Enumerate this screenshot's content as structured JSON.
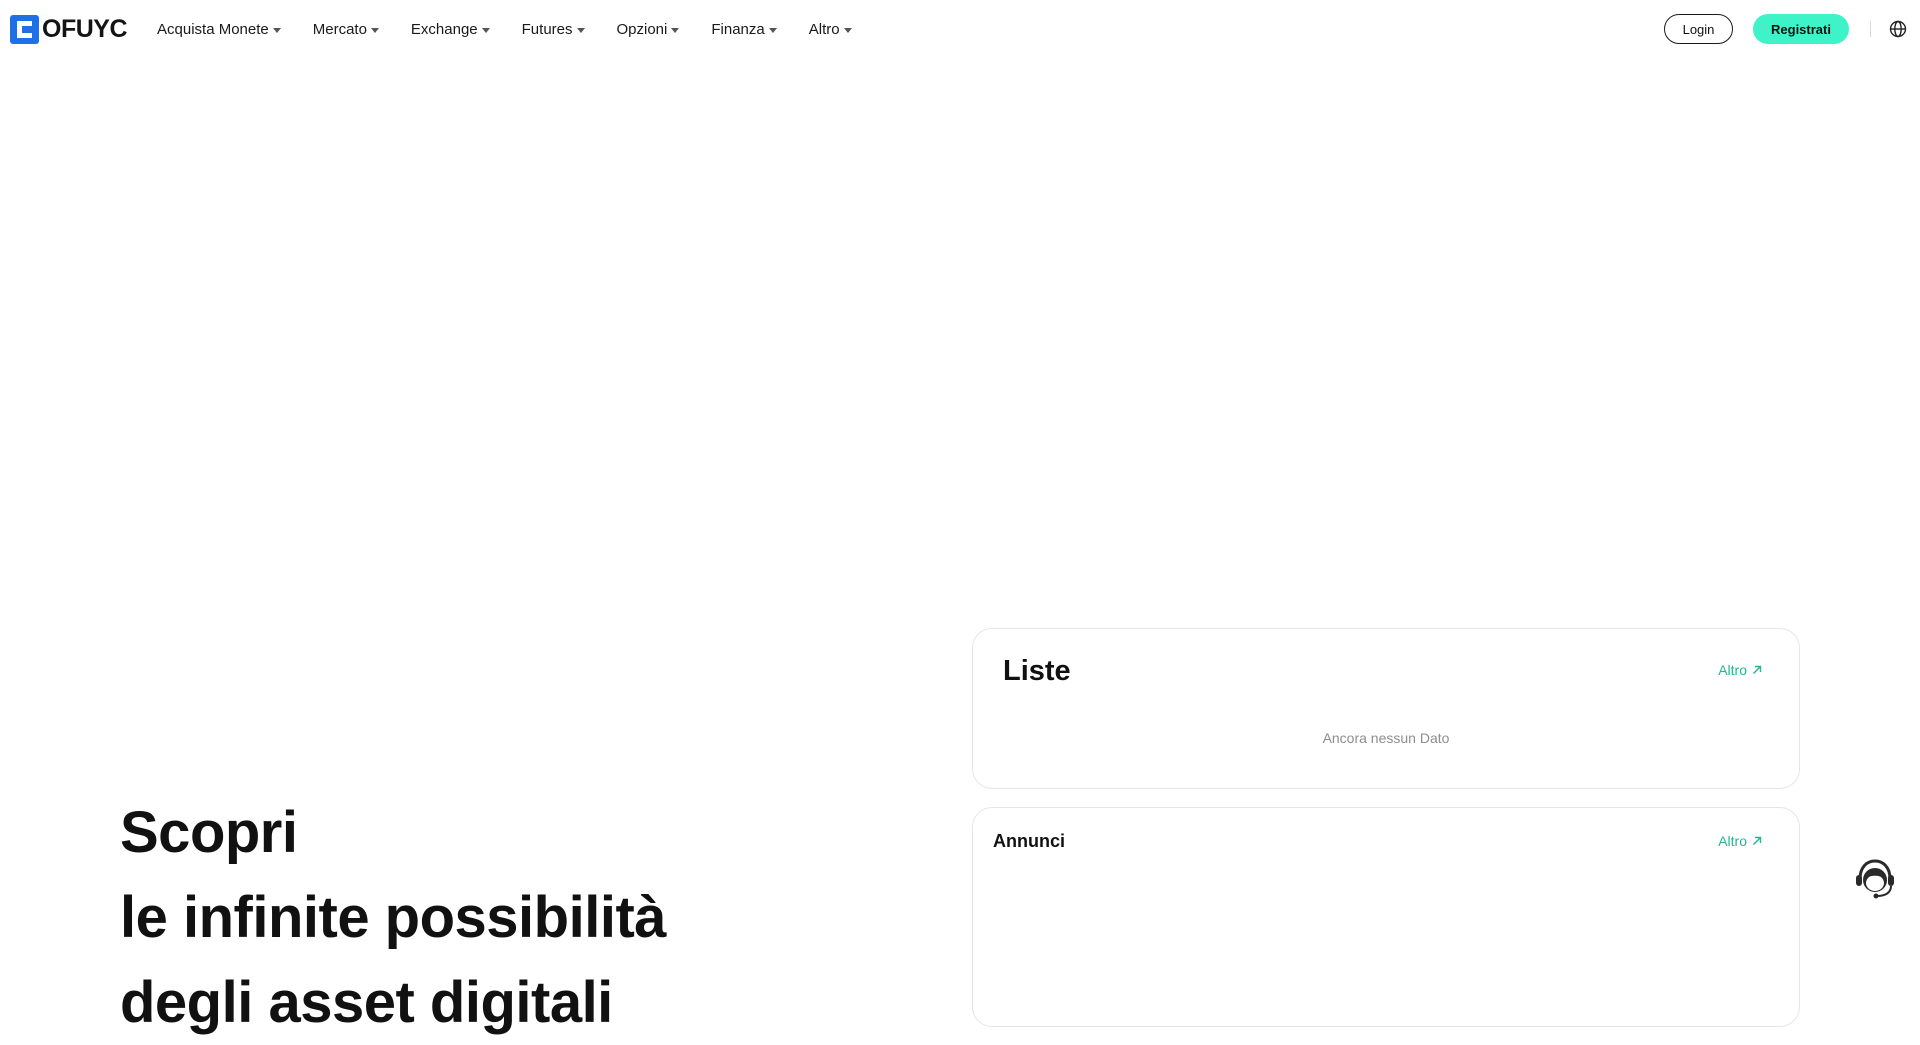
{
  "brand": {
    "name": "OFUYC",
    "color": "#1f6fe5"
  },
  "nav": {
    "items": [
      {
        "label": "Acquista Monete"
      },
      {
        "label": "Mercato"
      },
      {
        "label": "Exchange"
      },
      {
        "label": "Futures"
      },
      {
        "label": "Opzioni"
      },
      {
        "label": "Finanza"
      },
      {
        "label": "Altro"
      }
    ],
    "login_label": "Login",
    "register_label": "Registrati",
    "language_icon": "globe-icon"
  },
  "hero": {
    "lines": [
      "Scopri",
      "le infinite possibilità",
      "degli asset digitali"
    ]
  },
  "liste": {
    "title": "Liste",
    "more_label": "Altro",
    "empty_text": "Ancora nessun Dato"
  },
  "annunci": {
    "title": "Annunci",
    "more_label": "Altro"
  },
  "support": {
    "icon": "customer-support-icon"
  },
  "colors": {
    "accent": "#3ff3c8",
    "link": "#1fb892",
    "text": "#111111"
  }
}
